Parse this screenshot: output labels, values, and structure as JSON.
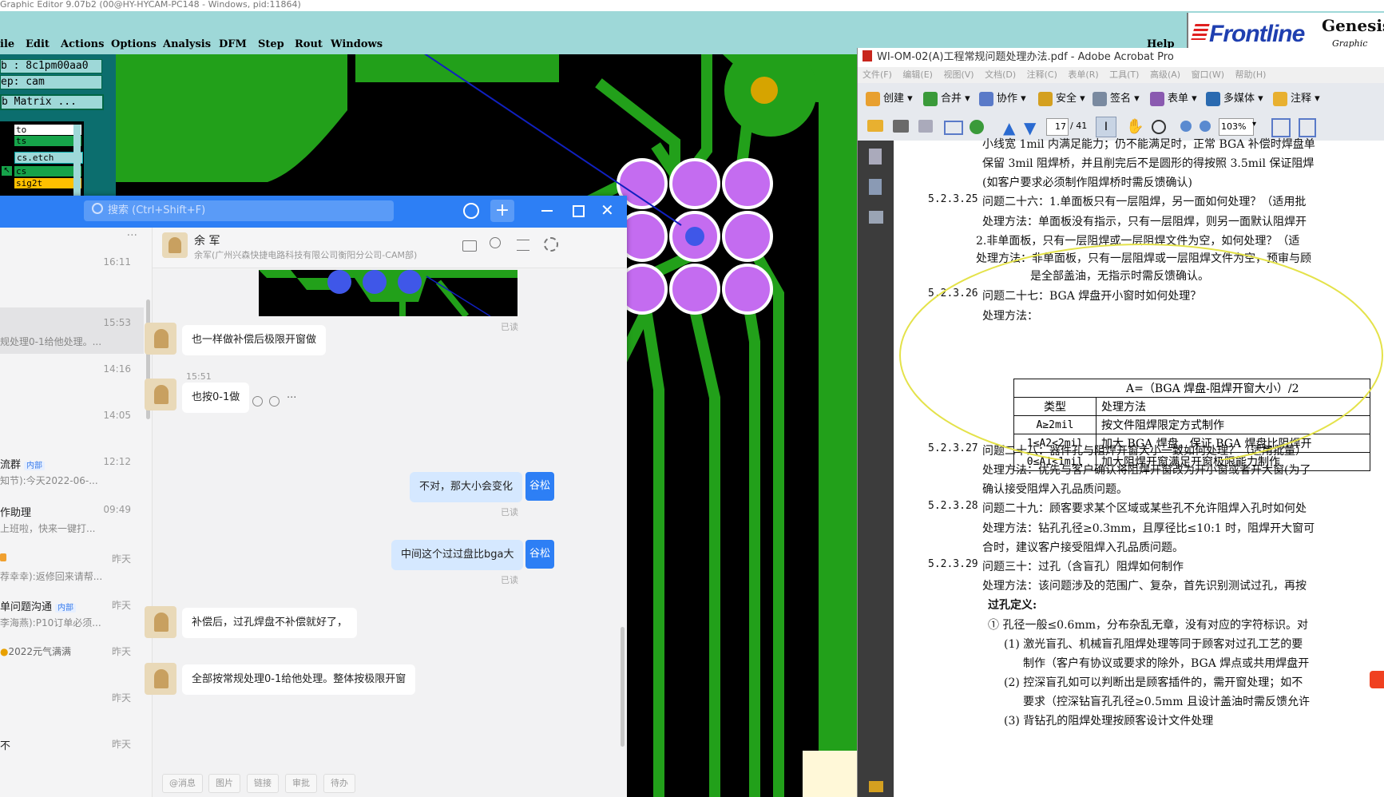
{
  "genesis": {
    "title": "Graphic Editor 9.07b2 (00@HY-HYCAM-PC148 - Windows, pid:11864)",
    "menu": [
      "ile",
      "Edit",
      "Actions",
      "Options",
      "Analysis",
      "DFM",
      "Step",
      "Rout",
      "Windows"
    ],
    "help": "Help",
    "logo_brand": "Frontline",
    "logo_product": "Genesis",
    "logo_sub": "Graphic",
    "job_label": "b : 8c1pm00aa0",
    "step_label": "ep: cam",
    "matrix_label": "b Matrix ...",
    "layers": [
      {
        "name": "to",
        "bg": "#ffffff"
      },
      {
        "name": "ts",
        "bg": "#16a34a"
      },
      {
        "name": "cs.etch",
        "bg": "#9ed8d8"
      },
      {
        "name": "cs",
        "bg": "#16a34a"
      },
      {
        "name": "sig2t",
        "bg": "#ffc000"
      }
    ],
    "colors": {
      "copper": "#22a01a",
      "pad": "#c46cf0",
      "highlight": "#3f57e8",
      "gold": "#d6a400"
    }
  },
  "chat": {
    "search_placeholder": "搜索 (Ctrl+Shift+F)",
    "more": "···",
    "contact_name": "余 军",
    "contact_org": "余军(广州兴森快捷电路科技有限公司衡阳分公司-CAM部)",
    "list": [
      {
        "name": "",
        "snippet": "",
        "time": "16:11"
      },
      {
        "name": "",
        "snippet": "规处理0-1给他处理。...",
        "time": "15:53"
      },
      {
        "name": "",
        "snippet": "",
        "time": "14:16"
      },
      {
        "name": "",
        "snippet": "",
        "time": "14:05"
      },
      {
        "name": "流群",
        "tag": "内部",
        "snippet": "知节):今天2022-06-...",
        "time": "12:12"
      },
      {
        "name": "作助理",
        "snippet": "上班啦，快来一键打...",
        "time": "09:49"
      },
      {
        "name": "",
        "snippet": "荐幸幸):返修回来请帮...",
        "time": "昨天"
      },
      {
        "name": "单问题沟通",
        "tag": "内部",
        "snippet": "李海燕):P10订单必须...",
        "time": "昨天"
      },
      {
        "name": "",
        "snippet": "2022元气满满",
        "time": "昨天"
      },
      {
        "name": "",
        "snippet": "",
        "time": "昨天"
      },
      {
        "name": "不",
        "snippet": "",
        "time": "昨天"
      }
    ],
    "read": "已读",
    "msg_time": "15:51",
    "messages": {
      "m1": "也一样做补偿后极限开窗做",
      "m2": "也按0-1做",
      "m3": "不对，那大小会变化",
      "m4": "中间这个过过盘比bga大",
      "m5": "补偿后，过孔焊盘不补偿就好了，",
      "m6": "全部按常规处理0-1给他处理。整体按极限开窗"
    },
    "me_name": "谷松",
    "toolbar": [
      "@消息",
      "图片",
      "链接",
      "审批",
      "待办"
    ]
  },
  "acrobat": {
    "title": "WI-OM-02(A)工程常规问题处理办法.pdf - Adobe Acrobat Pro",
    "menu": [
      "文件(F)",
      "编辑(E)",
      "视图(V)",
      "文档(D)",
      "注释(C)",
      "表单(R)",
      "工具(T)",
      "高级(A)",
      "窗口(W)",
      "帮助(H)"
    ],
    "toolbar1": [
      "创建",
      "合并",
      "协作",
      "安全",
      "签名",
      "表单",
      "多媒体",
      "注释"
    ],
    "page_current": "17",
    "page_total": "/ 41",
    "zoom": "103%",
    "lines": {
      "l1": "小线宽 1mil 内满足能力；仍不能满足时，正常 BGA 补偿时焊盘单",
      "l2": "保留 3mil 阻焊桥，并且削完后不是圆形的得按照 3.5mil 保证阻焊",
      "l3": "(如客户要求必须制作阻焊桥时需反馈确认)",
      "n25": "5.2.3.25",
      "q25": "问题二十六：1.单面板只有一层阻焊，另一面如何处理？（适用批",
      "l5": "处理方法：单面板没有指示，只有一层阻焊，则另一面默认阻焊开",
      "l6": "2.非单面板，只有一层阻焊或一层阻焊文件为空，如何处理？（适",
      "l7": "处理方法：非单面板，只有一层阻焊或一层阻焊文件为空，预审与顾",
      "l8": "是全部盖油，无指示时需反馈确认。",
      "n26": "5.2.3.26",
      "q26": "问题二十七：BGA 焊盘开小窗时如何处理？",
      "l10": "处理方法：",
      "n27": "5.2.3.27",
      "q27": "问题二十八：器件孔与阻焊开窗大小一致如何处理？（适用批量）",
      "l12": "处理方法：优先与客户确认将阻焊开窗改为开小窗或者开大窗(为了",
      "l13": "确认接受阻焊入孔品质问题。",
      "n28": "5.2.3.28",
      "q28": "问题二十九：顾客要求某个区域或某些孔不允许阻焊入孔时如何处",
      "l15": "处理方法：钻孔孔径≥0.3mm，且厚径比≤10:1 时，阻焊开大窗可",
      "l16": "合时，建议客户接受阻焊入孔品质问题。",
      "n29": "5.2.3.29",
      "q29": "问题三十：过孔（含盲孔）阻焊如何制作",
      "l18": "处理方法：该问题涉及的范围广、复杂，首先识别测试过孔，再按",
      "l19": "过孔定义:",
      "l20": "① 孔径一般≤0.6mm，分布杂乱无章，没有对应的字符标识。对",
      "l21": "(1) 激光盲孔、机械盲孔阻焊处理等同于顾客对过孔工艺的要",
      "l22": "制作（客户有协议或要求的除外，BGA 焊点或共用焊盘开",
      "l23": "(2) 控深盲孔如可以判断出是顾客插件的，需开窗处理；如不",
      "l24": "要求（控深钻盲孔孔径≥0.5mm 且设计盖油时需反馈允许",
      "l25": "(3) 背钻孔的阻焊处理按顾客设计文件处理"
    },
    "table": {
      "header": "A=（BGA 焊盘-阻焊开窗大小）/2",
      "col1": "类型",
      "col2": "处理方法",
      "rows": [
        [
          "A≥2mil",
          "按文件阻焊限定方式制作"
        ],
        [
          "1≤A2<2mil",
          "加大 BGA 焊盘，保证 BGA 焊盘比阻焊开"
        ],
        [
          "0≤A1<1mil",
          "加大阻焊开窗满足开窗极限能力制作"
        ]
      ]
    }
  }
}
